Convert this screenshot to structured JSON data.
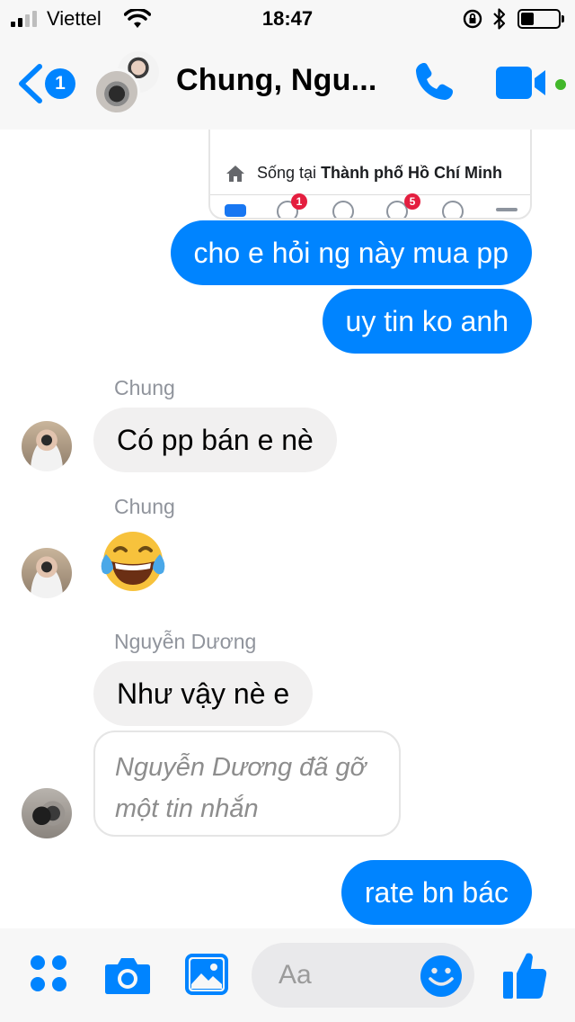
{
  "status_bar": {
    "carrier": "Viettel",
    "time": "18:47",
    "signal_bars": 2,
    "battery_level": 0.25
  },
  "header": {
    "back_badge": "1",
    "title": "Chung, Ngu...",
    "active_status_color": "#42b72a"
  },
  "shared_screenshot": {
    "location_prefix": "Sống tại ",
    "location_city": "Thành phố Hồ Chí Minh",
    "tab_badges": [
      "1",
      "5"
    ]
  },
  "messages": [
    {
      "from": "me",
      "text": "cho e hỏi ng này mua pp"
    },
    {
      "from": "me",
      "text": "uy tin ko anh"
    },
    {
      "from": "Chung",
      "sender_label": "Chung",
      "text": "Có pp bán e nè"
    },
    {
      "from": "Chung",
      "sender_label": "Chung",
      "emoji": "😂"
    },
    {
      "from": "Nguyễn Dương",
      "sender_label": "Nguyễn Dương",
      "text": "Như vậy nè e"
    },
    {
      "from": "Nguyễn Dương",
      "unsent_notice": "Nguyễn Dương đã gỡ một tin nhắn"
    },
    {
      "from": "me",
      "text": "rate bn bác"
    }
  ],
  "composer": {
    "placeholder": "Aa"
  },
  "colors": {
    "accent": "#0084ff",
    "incoming_bubble": "#f1f0f0",
    "bar_background": "#f7f7f7"
  }
}
